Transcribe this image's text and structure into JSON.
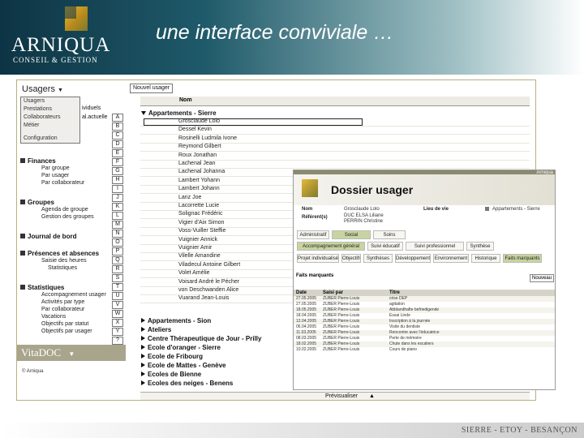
{
  "slide": {
    "title": "une interface conviviale …",
    "logo_name": "ARNIQUA",
    "logo_sub": "CONSEIL & GESTION",
    "footer": "SIERRE - ETOY - BESANÇON"
  },
  "sidebar": {
    "header": "Usagers",
    "dropdown": [
      "Usagers",
      "Prestations",
      "Collaborateurs",
      "Métier",
      "Configuration"
    ],
    "fragments": [
      "ividuels",
      "al.actuelle"
    ],
    "sections": [
      {
        "label": "Finances",
        "items": [
          "Par groupe",
          "Par usager",
          "Par collaborateur"
        ]
      },
      {
        "label": "Groupes",
        "items": [
          "Agenda de groupe",
          "Gestion des groupes"
        ]
      },
      {
        "label": "Journal de bord",
        "items": []
      },
      {
        "label": "Présences et absences",
        "items": [
          "Saisie des heures",
          "Statistiques"
        ]
      },
      {
        "label": "Statistiques",
        "items": [
          "Accompagnement usager",
          "Activités par type",
          "Par collaborateur",
          "Vacations",
          "Objectifs par statut",
          "Objectifs par usager"
        ]
      }
    ],
    "letters": [
      "A",
      "B",
      "C",
      "D",
      "E",
      "F",
      "G",
      "H",
      "I",
      "J",
      "K",
      "L",
      "M",
      "N",
      "O",
      "P",
      "Q",
      "R",
      "S",
      "T",
      "U",
      "V",
      "W",
      "X",
      "Y",
      "?"
    ],
    "vita_logo": "VitaDOC",
    "footer": "© Arniqua"
  },
  "main": {
    "new_user_label": "Nouvel usager",
    "column_header": "Nom",
    "open_group": "Appartements - Sierre",
    "users": [
      "Grosclaude Lolo",
      "Dessel Kevin",
      "Rosinelli Ludmila Ivone",
      "Reymond Gilbert",
      "Roux Jonathan",
      "Lachenal Jean",
      "Lachenal Johanna",
      "Lambert Yohann",
      "Lambert Johann",
      "Lanz Joe",
      "Lacorrette Lucie",
      "Solignac Frédéric",
      "Vigier d'Aix Simon",
      "Voss-Vuiller Steffie",
      "Vuignier Annick",
      "Vuignier Amir",
      "Vilelle Amandine",
      "Viladecul Antoine Gilbert",
      "Volet Amélie",
      "Voisard André le Pécher",
      "von Deschwanden Alice",
      "Vuarand Jean-Louis"
    ],
    "closed_groups": [
      "Appartements - Sion",
      "Ateliers",
      "Centre Thérapeutique de Jour - Prilly",
      "Ecole d'oranger - Sierre",
      "Ecole de Fribourg",
      "Ecole de Mattes - Genève",
      "Ecoles de Bienne",
      "Ecoles des neiges - Benens"
    ],
    "preview_label": "Prévisualiser"
  },
  "dossier": {
    "mini_label": "Arniqua",
    "title": "Dossier usager",
    "nom_label": "Nom",
    "nom_value": "Grosclaude Lolo",
    "referent_label": "Référent(s)",
    "referents": [
      "DUC ELSA Liliane",
      "PERRIN Christine"
    ],
    "lieu_label": "Lieu de vie",
    "lieu_value": "Appartements - Sierre",
    "tabs1": [
      "Administratif",
      "Social",
      "Soins"
    ],
    "tabs2": [
      "Accompagnement général",
      "Suivi éducatif",
      "Suivi professionnel",
      "Synthèse"
    ],
    "tabs3": [
      "Projet individualisé",
      "Objectifs",
      "Synthèses",
      "Développement",
      "Environnement",
      "Historique",
      "Faits marquants"
    ],
    "faits_label": "Faits marquants",
    "new_button": "Nouveau",
    "table_head": [
      "Date",
      "Saisi par",
      "Titre"
    ],
    "rows": [
      [
        "27.05.2005",
        "ZUBER Pierre-Louis",
        "crise DEP"
      ],
      [
        "27.05.2005",
        "ZUBER Pierre-Louis",
        "agitation"
      ],
      [
        "18.05.2005",
        "ZUBER Pierre-Louis",
        "Abblandhafte befriedigende"
      ],
      [
        "18.04.2005",
        "ZUBER Pierre-Louis",
        "Essai Linde"
      ],
      [
        "12.04.2005",
        "ZUBER Pierre-Louis",
        "Inscription à la journée"
      ],
      [
        "06.04.2005",
        "ZUBER Pierre-Louis",
        "Visite du dentiste"
      ],
      [
        "11.03.2005",
        "ZUBER Pierre-Louis",
        "Rencontre avec l'éducatrice"
      ],
      [
        "08.03.2005",
        "ZUBER Pierre-Louis",
        "Perte de mémoire"
      ],
      [
        "18.02.2005",
        "ZUBER Pierre-Louis",
        "Chute dans les escaliers"
      ],
      [
        "10.02.2005",
        "ZUBER Pierre-Louis",
        "Cours de piano"
      ]
    ]
  }
}
